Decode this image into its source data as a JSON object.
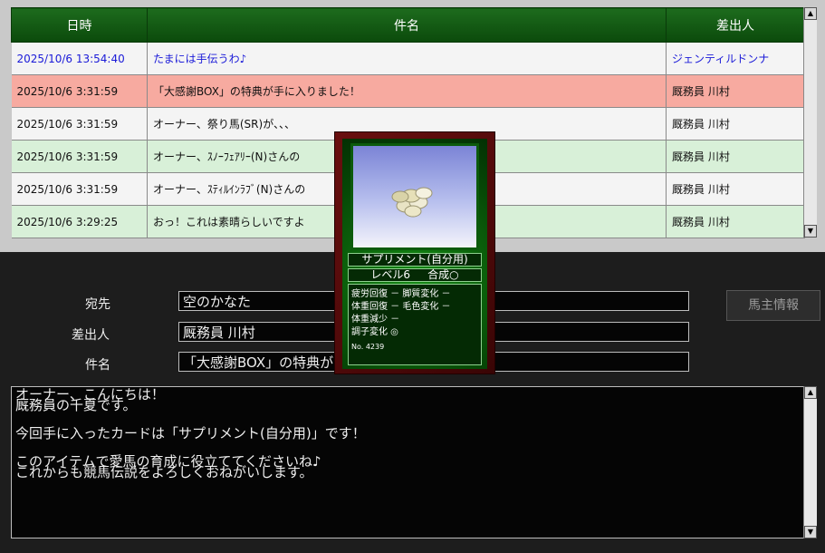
{
  "table": {
    "headers": {
      "datetime": "日時",
      "subject": "件名",
      "sender": "差出人"
    },
    "rows": [
      {
        "datetime": "2025/10/6 13:54:40",
        "subject": "たまには手伝うわ♪",
        "sender": "ジェンティルドンナ",
        "state": "unread"
      },
      {
        "datetime": "2025/10/6 3:31:59",
        "subject": "「大感謝BOX」の特典が手に入りました！",
        "sender": "厩務員 川村",
        "state": "selected"
      },
      {
        "datetime": "2025/10/6 3:31:59",
        "subject": "オーナー、祭り馬(SR)が、、、",
        "sender": "厩務員 川村",
        "state": "white"
      },
      {
        "datetime": "2025/10/6 3:31:59",
        "subject": "オーナー、ｽﾉｰﾌｪｱﾘｰ(N)さんの",
        "sender": "厩務員 川村",
        "state": "green"
      },
      {
        "datetime": "2025/10/6 3:31:59",
        "subject": "オーナー、ｽﾃｨﾙｲﾝﾗﾌﾞ(N)さんの",
        "sender": "厩務員 川村",
        "state": "white"
      },
      {
        "datetime": "2025/10/6 3:29:25",
        "subject": "おっ！これは素晴らしいですよ",
        "sender": "厩務員 川村",
        "state": "green"
      }
    ]
  },
  "detail": {
    "to_label": "宛先",
    "to_value": "空のかなた",
    "from_label": "差出人",
    "from_value": "厩務員 川村",
    "subject_label": "件名",
    "subject_value": "「大感謝BOX」の特典が",
    "owner_button": "馬主情報"
  },
  "message": {
    "lines": [
      "オーナー、こんにちは！",
      "厩務員の千夏です。",
      "",
      "今回手に入ったカードは「サプリメント(自分用)」です！",
      "",
      "このアイテムで愛馬の育成に役立ててくださいね♪",
      "これからも競馬伝説をよろしくおねがいします。"
    ]
  },
  "card": {
    "name": "サプリメント(自分用)",
    "level": "レベル6",
    "synthesis": "合成○",
    "stats": [
      "疲労回復 －  脚質変化 －",
      "体重回復 －  毛色変化 －",
      "体重減少 －",
      "調子変化 ◎"
    ],
    "number": "No. 4239",
    "image_icon": "supplement-pills-icon"
  },
  "colors": {
    "header_green": "#1d6b1d",
    "selected_row": "#f7aaa0",
    "alt_row_green": "#d8f0d8",
    "unread_text": "#1a1ad8"
  }
}
